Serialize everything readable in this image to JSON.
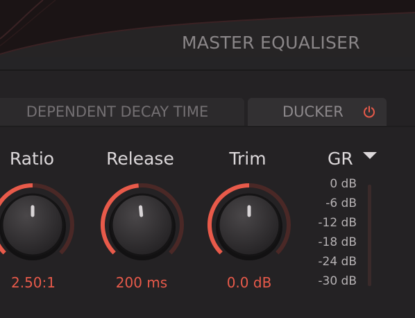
{
  "header": {
    "title": "MASTER EQUALISER"
  },
  "tabs": [
    {
      "label": "DEPENDENT DECAY TIME"
    },
    {
      "label": "DUCKER",
      "icon": "power-icon",
      "power_on": true
    }
  ],
  "knobs": [
    {
      "label": "Ratio",
      "value": "2.50:1",
      "level": 0.5
    },
    {
      "label": "Release",
      "value": "200 ms",
      "level": 0.48
    },
    {
      "label": "Trim",
      "value": "0.0 dB",
      "level": 0.5
    }
  ],
  "gr": {
    "label": "GR",
    "dropdown_icon": "chevron-down-icon",
    "scale": [
      "0 dB",
      "-6 dB",
      "-12 dB",
      "-18 dB",
      "-24 dB",
      "-30 dB"
    ]
  },
  "colors": {
    "accent": "#e85a4a",
    "arc_track": "#4a2826",
    "text_primary": "#dcd8da",
    "text_dim": "#8a8688"
  }
}
